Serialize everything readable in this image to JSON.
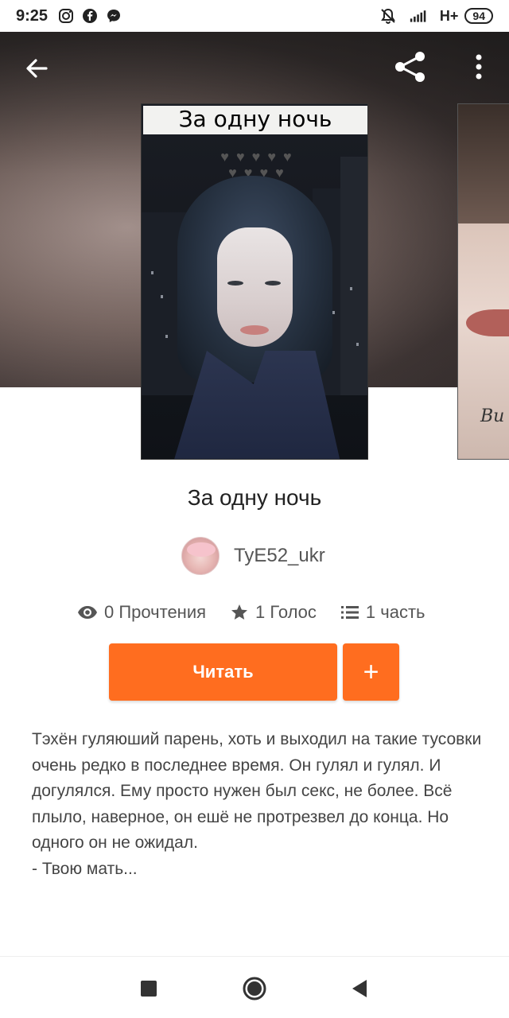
{
  "status_bar": {
    "time": "9:25",
    "network": "H+",
    "battery": "94"
  },
  "hero": {
    "cover_caption": "За одну ночь",
    "second_cover_caption": "Bu"
  },
  "story": {
    "title": "За одну ночь",
    "author": "TyE52_ukr",
    "stats": {
      "reads": "0 Прочтения",
      "votes": "1 Голос",
      "parts": "1 часть"
    },
    "read_button": "Читать",
    "add_button": "+",
    "description": "Тэхён гуляюший парень, хоть и выходил на такие тусовки очень редко в последнее время. Он гулял и гулял. И догулялся. Ему просто нужен был секс, не более. Всё плыло, наверное, он ешё не протрезвел до конца. Но одного он не ожидал.\n- Твою мать..."
  },
  "colors": {
    "accent": "#ff6d1f",
    "text_primary": "#222222",
    "text_secondary": "#555555"
  },
  "icons": {
    "back": "arrow-left-icon",
    "share": "share-icon",
    "more": "more-vertical-icon",
    "reads": "eye-icon",
    "votes": "star-icon",
    "parts": "list-icon",
    "nav_recent": "square-icon",
    "nav_home": "circle-icon",
    "nav_back": "triangle-back-icon"
  }
}
